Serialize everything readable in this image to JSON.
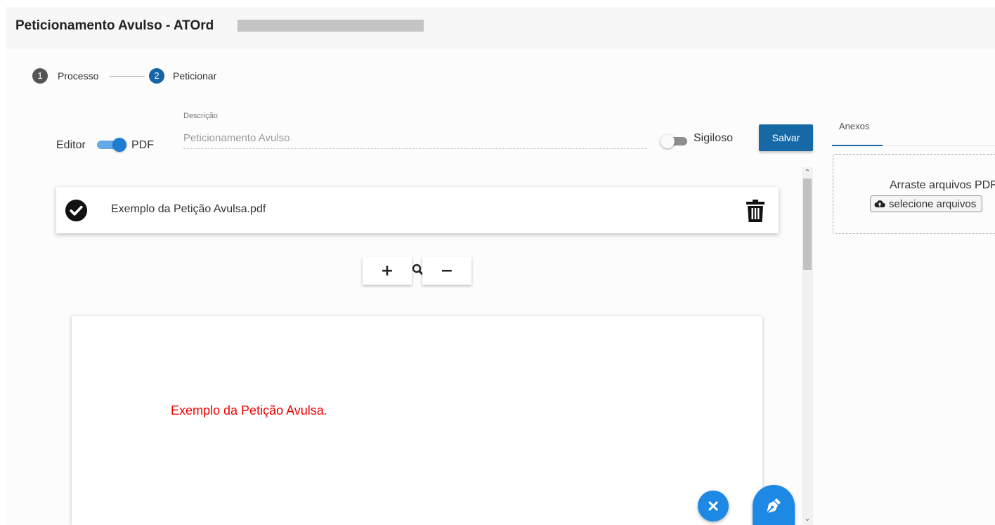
{
  "header": {
    "title": "Peticionamento Avulso - ATOrd"
  },
  "stepper": {
    "steps": [
      {
        "number": "1",
        "label": "Processo"
      },
      {
        "number": "2",
        "label": "Peticionar"
      }
    ]
  },
  "mode_toggle": {
    "left_label": "Editor",
    "right_label": "PDF",
    "active": "PDF"
  },
  "description": {
    "label": "Descrição",
    "value": "Peticionamento Avulso"
  },
  "sigiloso": {
    "label": "Sigiloso",
    "checked": false
  },
  "save_label": "Salvar",
  "attachments": {
    "tab_label": "Anexos",
    "drop_text": "Arraste arquivos PDF",
    "select_label": "selecione arquivos"
  },
  "file": {
    "name": "Exemplo da Petição Avulsa.pdf"
  },
  "zoom": {
    "in_label": "+",
    "out_label": "−"
  },
  "pdf_preview": {
    "text": "Exemplo da Petição Avulsa."
  },
  "icons": {
    "step_complete": "circle-number",
    "upload": "cloud-upload-icon",
    "check": "check-circle-icon",
    "delete": "trash-icon",
    "zoom": "search-icon",
    "close": "close-icon",
    "sign": "pen-nib-icon"
  },
  "colors": {
    "primary": "#1769a5",
    "accent": "#1e88e5",
    "pdf_text": "#ee0000",
    "step_inactive": "#555555"
  }
}
